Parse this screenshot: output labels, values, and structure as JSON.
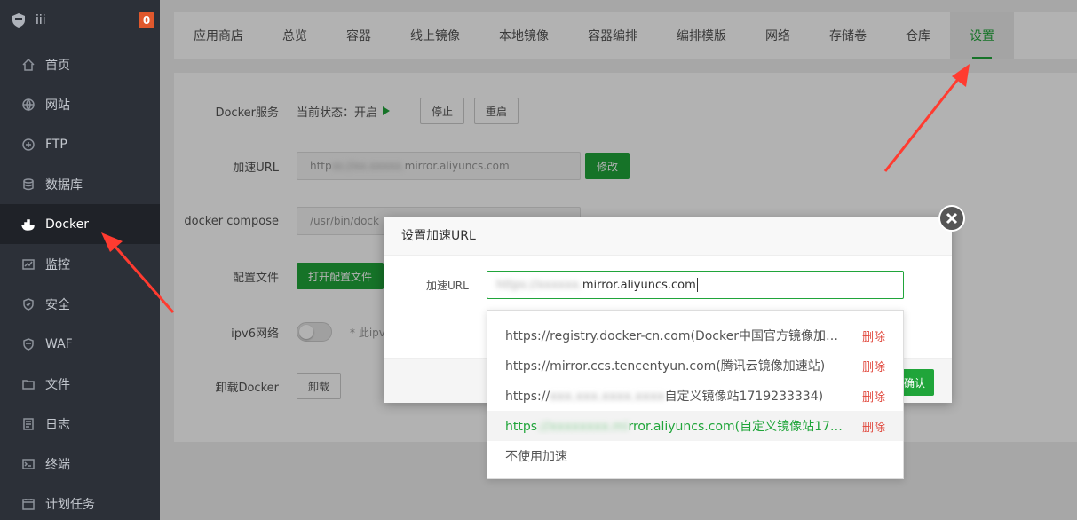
{
  "sidebar": {
    "user": "iii",
    "badge": "0",
    "items": [
      {
        "label": "首页",
        "icon": "home-icon"
      },
      {
        "label": "网站",
        "icon": "globe-icon"
      },
      {
        "label": "FTP",
        "icon": "ftp-icon"
      },
      {
        "label": "数据库",
        "icon": "database-icon"
      },
      {
        "label": "Docker",
        "icon": "docker-icon",
        "active": true
      },
      {
        "label": "监控",
        "icon": "monitor-icon"
      },
      {
        "label": "安全",
        "icon": "shield-icon"
      },
      {
        "label": "WAF",
        "icon": "waf-shield-icon"
      },
      {
        "label": "文件",
        "icon": "folder-icon"
      },
      {
        "label": "日志",
        "icon": "log-icon"
      },
      {
        "label": "终端",
        "icon": "terminal-icon"
      },
      {
        "label": "计划任务",
        "icon": "calendar-icon"
      }
    ]
  },
  "tabs": [
    "应用商店",
    "总览",
    "容器",
    "线上镜像",
    "本地镜像",
    "容器编排",
    "编排模版",
    "网络",
    "存储卷",
    "仓库",
    "设置"
  ],
  "active_tab": "设置",
  "settings": {
    "docker_service_label": "Docker服务",
    "status_text": "当前状态：开启",
    "stop_label": "停止",
    "restart_label": "重启",
    "accel_label": "加速URL",
    "accel_value_prefix": "http",
    "accel_value_suffix": "mirror.aliyuncs.com",
    "modify_label": "修改",
    "compose_label": "docker compose",
    "compose_value": "/usr/bin/dock",
    "config_label": "配置文件",
    "open_config_label": "打开配置文件",
    "ipv6_label": "ipv6网络",
    "ipv6_hint": "* 此ipv",
    "uninstall_label": "卸载Docker",
    "uninstall_btn": "卸载"
  },
  "dialog": {
    "title": "设置加速URL",
    "field_label": "加速URL",
    "input_value_suffix": "mirror.aliyuncs.com",
    "confirm_label": "确认"
  },
  "dropdown": {
    "delete_label": "删除",
    "items": [
      {
        "text": "https://registry.docker-cn.com(Docker中国官方镜像加速..."
      },
      {
        "text": "https://mirror.ccs.tencentyun.com(腾讯云镜像加速站)"
      },
      {
        "text_prefix": "https://",
        "text_suffix": "自定义镜像站1719233334)"
      },
      {
        "text_prefix": "https",
        "text_suffix": "rror.aliyuncs.com(自定义镜像站171...",
        "selected": true
      }
    ],
    "no_accel_label": "不使用加速"
  },
  "colors": {
    "accent": "#20a53a",
    "danger": "#e0453a",
    "sidebar_bg": "#2c3038",
    "arrow": "#ff3b30"
  }
}
